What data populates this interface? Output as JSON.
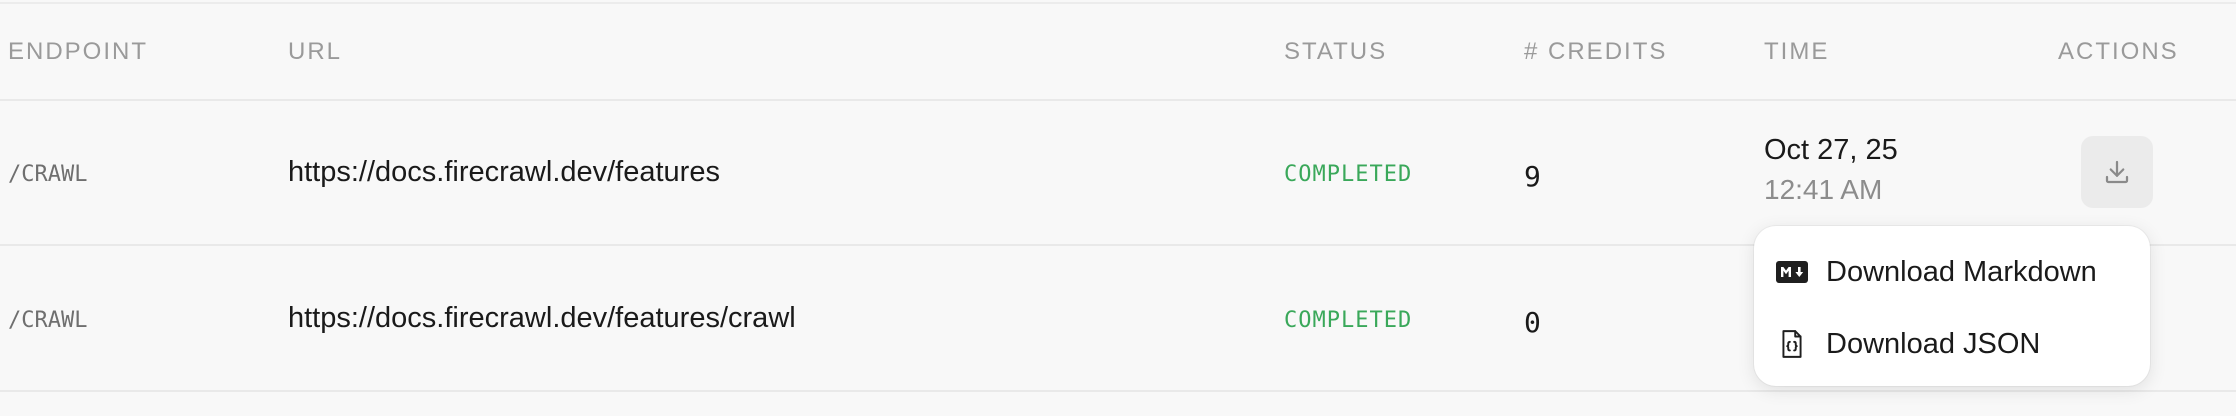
{
  "columns": {
    "endpoint": "ENDPOINT",
    "url": "URL",
    "status": "STATUS",
    "credits": "# CREDITS",
    "time": "TIME",
    "actions": "ACTIONS"
  },
  "rows": [
    {
      "endpoint": "/CRAWL",
      "url": "https://docs.firecrawl.dev/features",
      "status": "COMPLETED",
      "credits": "9",
      "date": "Oct 27, 25",
      "clock": "12:41 AM",
      "action_icon": "download-icon"
    },
    {
      "endpoint": "/CRAWL",
      "url": "https://docs.firecrawl.dev/features/crawl",
      "status": "COMPLETED",
      "credits": "0"
    }
  ],
  "download_menu": {
    "items": [
      {
        "label": "Download Markdown",
        "icon": "markdown-icon"
      },
      {
        "label": "Download JSON",
        "icon": "json-file-icon"
      }
    ]
  },
  "colors": {
    "status_completed": "#3aa85a",
    "header_text": "#9a9a9a",
    "background": "#f8f8f8"
  }
}
